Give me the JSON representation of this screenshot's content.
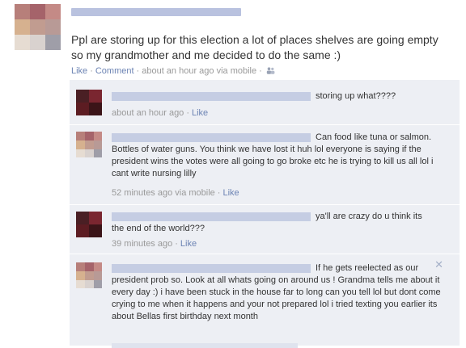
{
  "post": {
    "status_text": "Ppl are storing up for this election a lot of places shelves are going empty so my grandmother and me decided to do the same :)",
    "like_label": "Like",
    "comment_label": "Comment",
    "timestamp": "about an hour ago via mobile",
    "separator": "·",
    "audience_icon": "people-icon"
  },
  "comments": [
    {
      "text": "storing up what????",
      "timestamp": "about an hour ago",
      "like_label": "Like"
    },
    {
      "text": "Can food like tuna or salmon. Bottles of water guns. You think we have lost it huh lol everyone is saying if the president wins the votes were all going to go broke etc he is trying to kill us all lol i cant write nursing lilly",
      "timestamp": "52 minutes ago via mobile",
      "like_label": "Like"
    },
    {
      "text": "ya'll are crazy do u think its the end of the world???",
      "timestamp": "39 minutes ago",
      "like_label": "Like"
    },
    {
      "text": "If he gets reelected as our president prob so. Look at all whats going on around us ! Grandma tells me about it every day :) i have been stuck in the house far to long can you tell lol but dont come crying to me when it happens and your not prepared lol i tried texting you earlier its about Bellas first birthday next month",
      "close_icon": "close-icon"
    }
  ],
  "colors": {
    "link": "#6d84b4",
    "meta": "#999999",
    "comment_bg": "#edeff4",
    "text": "#333333"
  }
}
